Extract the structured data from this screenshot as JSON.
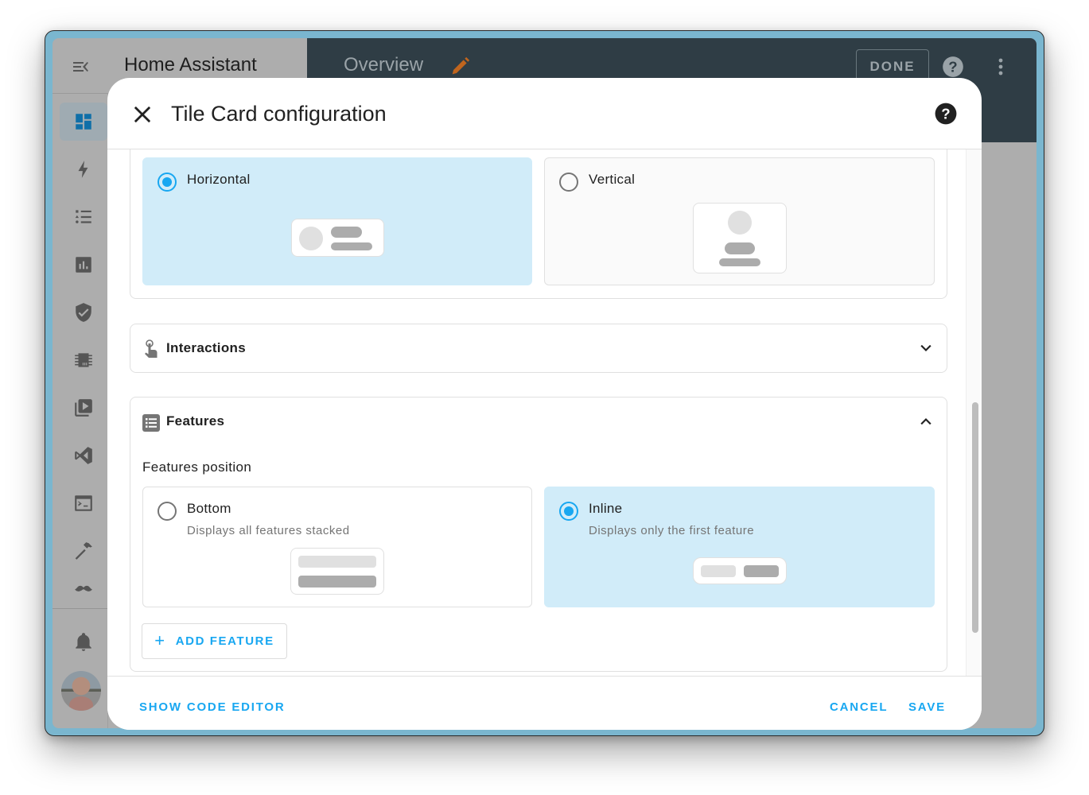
{
  "app": {
    "title": "Home Assistant",
    "menu_icon": "menu-open-icon"
  },
  "header": {
    "title": "Overview",
    "edit_icon": "pencil-icon",
    "done_label": "DONE",
    "help_icon": "help-circle-icon",
    "more_icon": "dots-vertical-icon"
  },
  "sidebar": {
    "items": [
      {
        "name": "overview",
        "icon": "view-dashboard-icon",
        "active": true
      },
      {
        "name": "energy",
        "icon": "lightning-bolt-icon",
        "active": false
      },
      {
        "name": "logbook",
        "icon": "format-list-bulleted-type-icon",
        "active": false
      },
      {
        "name": "history",
        "icon": "chart-box-icon",
        "active": false
      },
      {
        "name": "security",
        "icon": "shield-check-icon",
        "active": false
      },
      {
        "name": "hardware",
        "icon": "chip-icon",
        "active": false
      },
      {
        "name": "media",
        "icon": "play-box-multiple-icon",
        "active": false
      },
      {
        "name": "vscode",
        "icon": "microsoft-visual-studio-code-icon",
        "active": false
      },
      {
        "name": "terminal",
        "icon": "console-icon",
        "active": false
      },
      {
        "name": "developer-tools",
        "icon": "hammer-icon",
        "active": false
      },
      {
        "name": "hacs",
        "icon": "mustache-icon",
        "active": false
      }
    ],
    "notifications_icon": "bell-icon",
    "avatar": "user-avatar"
  },
  "dialog": {
    "title": "Tile Card configuration",
    "close_icon": "close-icon",
    "help_icon": "help-circle-icon",
    "content_layout": {
      "options": [
        {
          "label": "Horizontal",
          "selected": true
        },
        {
          "label": "Vertical",
          "selected": false
        }
      ]
    },
    "interactions": {
      "title": "Interactions",
      "icon": "gesture-tap-icon",
      "expanded": false
    },
    "features": {
      "title": "Features",
      "icon": "list-box-icon",
      "expanded": true,
      "position_label": "Features position",
      "options": [
        {
          "label": "Bottom",
          "description": "Displays all features stacked",
          "selected": false
        },
        {
          "label": "Inline",
          "description": "Displays only the first feature",
          "selected": true
        }
      ],
      "add_button": "ADD FEATURE"
    },
    "footer": {
      "code_editor": "SHOW CODE EDITOR",
      "cancel": "CANCEL",
      "save": "SAVE"
    }
  },
  "colors": {
    "accent": "#18a7f1",
    "selected_bg": "#d1ecf9",
    "header_bg": "#2f3d45",
    "edit_pencil": "#c0651e",
    "frame": "#7ab6cf"
  }
}
